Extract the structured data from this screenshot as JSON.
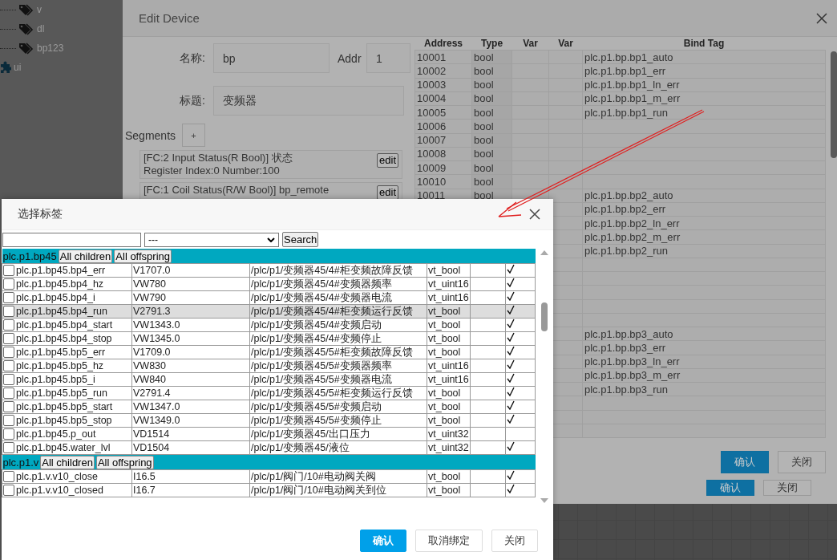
{
  "tree": {
    "items": [
      {
        "label": "v",
        "kind": "tag"
      },
      {
        "label": "dl",
        "kind": "tag"
      },
      {
        "label": "bp123",
        "kind": "tag"
      },
      {
        "label": "ui",
        "kind": "module"
      }
    ]
  },
  "edit_device": {
    "title": "Edit Device",
    "form": {
      "name_label": "名称:",
      "name_value": "bp",
      "addr_label": "Addr",
      "addr_value": "1",
      "title_label": "标题:",
      "title_value": "变频器",
      "segments_label": "Segments",
      "add_button": "+",
      "segments": [
        {
          "lines": [
            "[FC:2 Input Status(R Bool)] 状态",
            "Register Index:0 Number:100"
          ],
          "edit": "edit"
        },
        {
          "lines": [
            "[FC:1 Coil Status(R/W Bool)] bp_remote"
          ],
          "edit": "edit"
        }
      ]
    },
    "table": {
      "columns": [
        "Address",
        "Type",
        "Var",
        "Var",
        "Bind Tag"
      ],
      "rows": [
        {
          "address": "10001",
          "type": "bool",
          "bind_tag": "plc.p1.bp.bp1_auto"
        },
        {
          "address": "10002",
          "type": "bool",
          "bind_tag": "plc.p1.bp.bp1_err"
        },
        {
          "address": "10003",
          "type": "bool",
          "bind_tag": "plc.p1.bp.bp1_ln_err"
        },
        {
          "address": "10004",
          "type": "bool",
          "bind_tag": "plc.p1.bp.bp1_m_err"
        },
        {
          "address": "10005",
          "type": "bool",
          "bind_tag": "plc.p1.bp.bp1_run"
        },
        {
          "address": "10006",
          "type": "bool"
        },
        {
          "address": "10007",
          "type": "bool"
        },
        {
          "address": "10008",
          "type": "bool"
        },
        {
          "address": "10009",
          "type": "bool"
        },
        {
          "address": "10010",
          "type": "bool"
        },
        {
          "address": "10011",
          "type": "bool",
          "bind_tag": "plc.p1.bp.bp2_auto"
        },
        {
          "bind_tag": "plc.p1.bp.bp2_err"
        },
        {
          "bind_tag": "plc.p1.bp.bp2_ln_err"
        },
        {
          "bind_tag": "plc.p1.bp.bp2_m_err"
        },
        {
          "bind_tag": "plc.p1.bp.bp2_run"
        },
        {},
        {},
        {},
        {},
        {},
        {
          "bind_tag": "plc.p1.bp.bp3_auto"
        },
        {
          "bind_tag": "plc.p1.bp.bp3_err"
        },
        {
          "bind_tag": "plc.p1.bp.bp3_ln_err"
        },
        {
          "bind_tag": "plc.p1.bp.bp3_m_err"
        },
        {
          "bind_tag": "plc.p1.bp.bp3_run"
        },
        {},
        {},
        {}
      ]
    },
    "buttons": [
      {
        "label": "确认",
        "primary": true
      },
      {
        "label": "关闭",
        "primary": false
      }
    ],
    "back_buttons": [
      {
        "label": "确认",
        "primary": true
      },
      {
        "label": "关闭",
        "primary": false
      }
    ]
  },
  "select_tag": {
    "title": "选择标签",
    "search": {
      "select": "---",
      "button": "Search"
    },
    "groups": [
      {
        "name": "plc.p1.bp45",
        "buttons": [
          "All children",
          "All offspring"
        ],
        "rows": [
          {
            "name": "plc.p1.bp45.bp4_err",
            "address": "V1707.0",
            "path": "/plc/p1/变频器45/4#柜变频故障反馈",
            "type": "vt_bool",
            "ticked": true,
            "checked": false,
            "selected": false
          },
          {
            "name": "plc.p1.bp45.bp4_hz",
            "address": "VW780",
            "path": "/plc/p1/变频器45/4#变频器频率",
            "type": "vt_uint16",
            "ticked": true,
            "checked": false,
            "selected": false
          },
          {
            "name": "plc.p1.bp45.bp4_i",
            "address": "VW790",
            "path": "/plc/p1/变频器45/4#变频器电流",
            "type": "vt_uint16",
            "ticked": true,
            "checked": false,
            "selected": false
          },
          {
            "name": "plc.p1.bp45.bp4_run",
            "address": "V2791.3",
            "path": "/plc/p1/变频器45/4#柜变频运行反馈",
            "type": "vt_bool",
            "ticked": true,
            "checked": false,
            "selected": true
          },
          {
            "name": "plc.p1.bp45.bp4_start",
            "address": "VW1343.0",
            "path": "/plc/p1/变频器45/4#变频启动",
            "type": "vt_bool",
            "ticked": true,
            "checked": false,
            "selected": false
          },
          {
            "name": "plc.p1.bp45.bp4_stop",
            "address": "VW1345.0",
            "path": "/plc/p1/变频器45/4#变频停止",
            "type": "vt_bool",
            "ticked": true,
            "checked": false,
            "selected": false
          },
          {
            "name": "plc.p1.bp45.bp5_err",
            "address": "V1709.0",
            "path": "/plc/p1/变频器45/5#柜变频故障反馈",
            "type": "vt_bool",
            "ticked": true,
            "checked": false,
            "selected": false
          },
          {
            "name": "plc.p1.bp45.bp5_hz",
            "address": "VW830",
            "path": "/plc/p1/变频器45/5#变频器频率",
            "type": "vt_uint16",
            "ticked": true,
            "checked": false,
            "selected": false
          },
          {
            "name": "plc.p1.bp45.bp5_i",
            "address": "VW840",
            "path": "/plc/p1/变频器45/5#变频器电流",
            "type": "vt_uint16",
            "ticked": true,
            "checked": false,
            "selected": false
          },
          {
            "name": "plc.p1.bp45.bp5_run",
            "address": "V2791.4",
            "path": "/plc/p1/变频器45/5#柜变频运行反馈",
            "type": "vt_bool",
            "ticked": true,
            "checked": false,
            "selected": false
          },
          {
            "name": "plc.p1.bp45.bp5_start",
            "address": "VW1347.0",
            "path": "/plc/p1/变频器45/5#变频启动",
            "type": "vt_bool",
            "ticked": true,
            "checked": false,
            "selected": false
          },
          {
            "name": "plc.p1.bp45.bp5_stop",
            "address": "VW1349.0",
            "path": "/plc/p1/变频器45/5#变频停止",
            "type": "vt_bool",
            "ticked": true,
            "checked": false,
            "selected": false
          },
          {
            "name": "plc.p1.bp45.p_out",
            "address": "VD1514",
            "path": "/plc/p1/变频器45/出口压力",
            "type": "vt_uint32",
            "ticked": false,
            "checked": false,
            "selected": false
          },
          {
            "name": "plc.p1.bp45.water_lvl",
            "address": "VD1504",
            "path": "/plc/p1/变频器45/液位",
            "type": "vt_uint32",
            "ticked": true,
            "checked": false,
            "selected": false
          }
        ]
      },
      {
        "name": "plc.p1.v",
        "buttons": [
          "All children",
          "All offspring"
        ],
        "rows": [
          {
            "name": "plc.p1.v.v10_close",
            "address": "I16.5",
            "path": "/plc/p1/阀门/10#电动阀关阀",
            "type": "vt_bool",
            "ticked": true,
            "checked": false,
            "selected": false
          },
          {
            "name": "plc.p1.v.v10_closed",
            "address": "I16.7",
            "path": "/plc/p1/阀门/10#电动阀关到位",
            "type": "vt_bool",
            "ticked": true,
            "checked": false,
            "selected": false
          }
        ]
      }
    ],
    "buttons": [
      {
        "label": "确认",
        "primary": true
      },
      {
        "label": "取消绑定",
        "primary": false
      },
      {
        "label": "关闭",
        "primary": false
      }
    ]
  }
}
